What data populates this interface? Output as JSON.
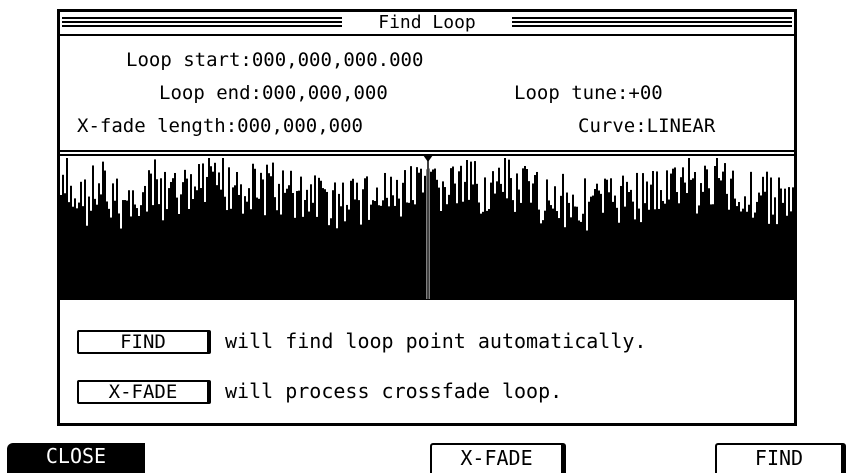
{
  "dialog": {
    "title": "Find Loop",
    "params": {
      "loop_start": "Loop start:000,000,000.000",
      "loop_end": "Loop end:000,000,000",
      "loop_tune": "Loop tune:+00",
      "xfade_length": "X-fade length:000,000,000",
      "curve": "Curve:LINEAR"
    },
    "find_hint": {
      "button": "FIND",
      "text": "will find loop point automatically."
    },
    "xfade_hint": {
      "button": "X-FADE",
      "text": "will process crossfade loop."
    }
  },
  "softkeys": {
    "close": "CLOSE",
    "xfade": "X-FADE",
    "find": "FIND"
  }
}
